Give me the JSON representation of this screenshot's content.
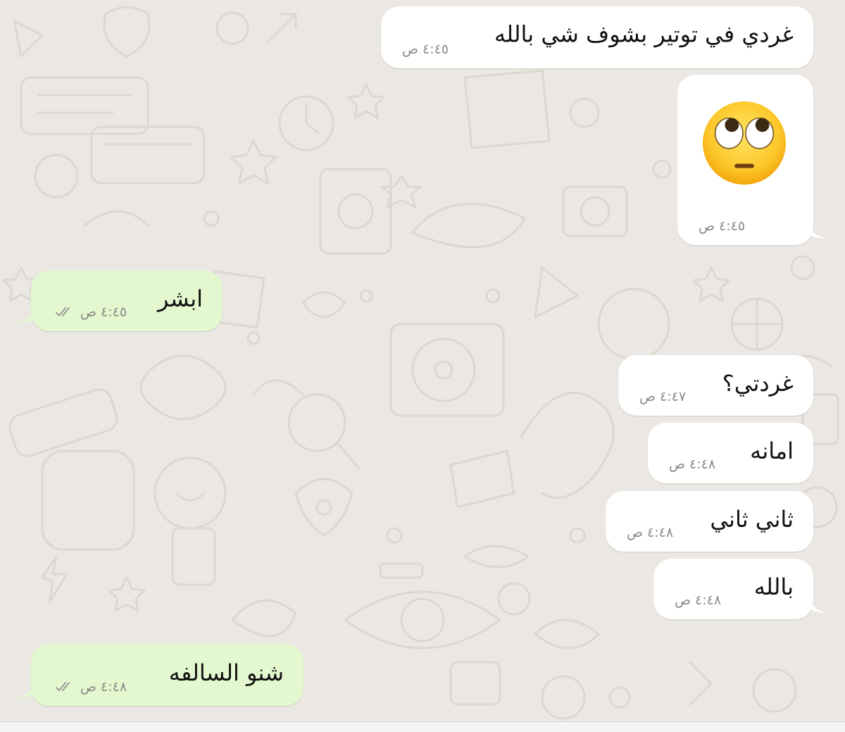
{
  "messages": [
    {
      "id": "m1",
      "side": "incoming",
      "text": "غردي في توتير بشوف شي بالله",
      "time": "٤:٤٥ ص"
    },
    {
      "id": "m2",
      "side": "incoming",
      "emoji": "face-with-rolling-eyes",
      "time": "٤:٤٥ ص"
    },
    {
      "id": "m3",
      "side": "outgoing",
      "text": "ابشر",
      "time": "٤:٤٥ ص",
      "status": "read"
    },
    {
      "id": "m4",
      "side": "incoming",
      "text": "غردتي؟",
      "time": "٤:٤٧ ص"
    },
    {
      "id": "m5",
      "side": "incoming",
      "text": "امانه",
      "time": "٤:٤٨ ص"
    },
    {
      "id": "m6",
      "side": "incoming",
      "text": "ثاني ثاني",
      "time": "٤:٤٨ ص"
    },
    {
      "id": "m7",
      "side": "incoming",
      "text": "بالله",
      "time": "٤:٤٨ ص"
    },
    {
      "id": "m8",
      "side": "outgoing",
      "text": "شنو السالفه",
      "time": "٤:٤٨ ص",
      "status": "read"
    }
  ],
  "colors": {
    "wallpaper": "#ebe7e2",
    "incoming_bubble": "#ffffff",
    "outgoing_bubble": "#e4f8cf",
    "timestamp": "#8a8a8a",
    "read_ticks": "#9a9a9a"
  }
}
